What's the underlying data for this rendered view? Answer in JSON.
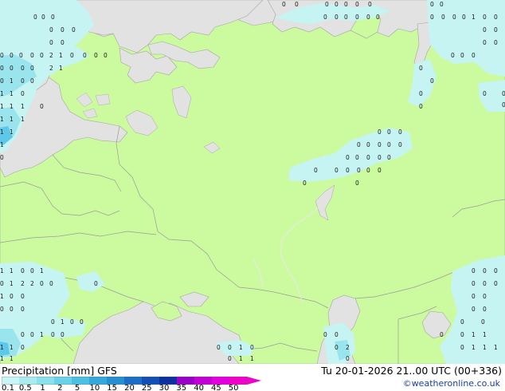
{
  "legend": {
    "title": "Precipitation [mm]",
    "model": "GFS",
    "datetime": "Tu 20-01-2026 21..00 UTC (00+336)",
    "copyright": "©weatheronline.co.uk",
    "ticks": [
      "0.1",
      "0.5",
      "1",
      "2",
      "5",
      "10",
      "15",
      "20",
      "25",
      "30",
      "35",
      "40",
      "45",
      "50"
    ],
    "colors": [
      "#c8f5f5",
      "#a8ecf0",
      "#8ae0ec",
      "#6ad2e8",
      "#4cc0e2",
      "#34a8da",
      "#2490d2",
      "#1a6ec8",
      "#1250b8",
      "#0d2fa0",
      "#9a00c8",
      "#c400d8",
      "#e400e0",
      "#f000c8"
    ]
  },
  "map": {
    "land_color": "#ccfa9e",
    "sea_color": "#e2e2e2",
    "border_color": "#a0a0a0",
    "precip_light_color": "#c6f4f2",
    "precip_mid_color": "#9ae4ee",
    "precip_heavy_color": "#5ec8e8"
  }
}
